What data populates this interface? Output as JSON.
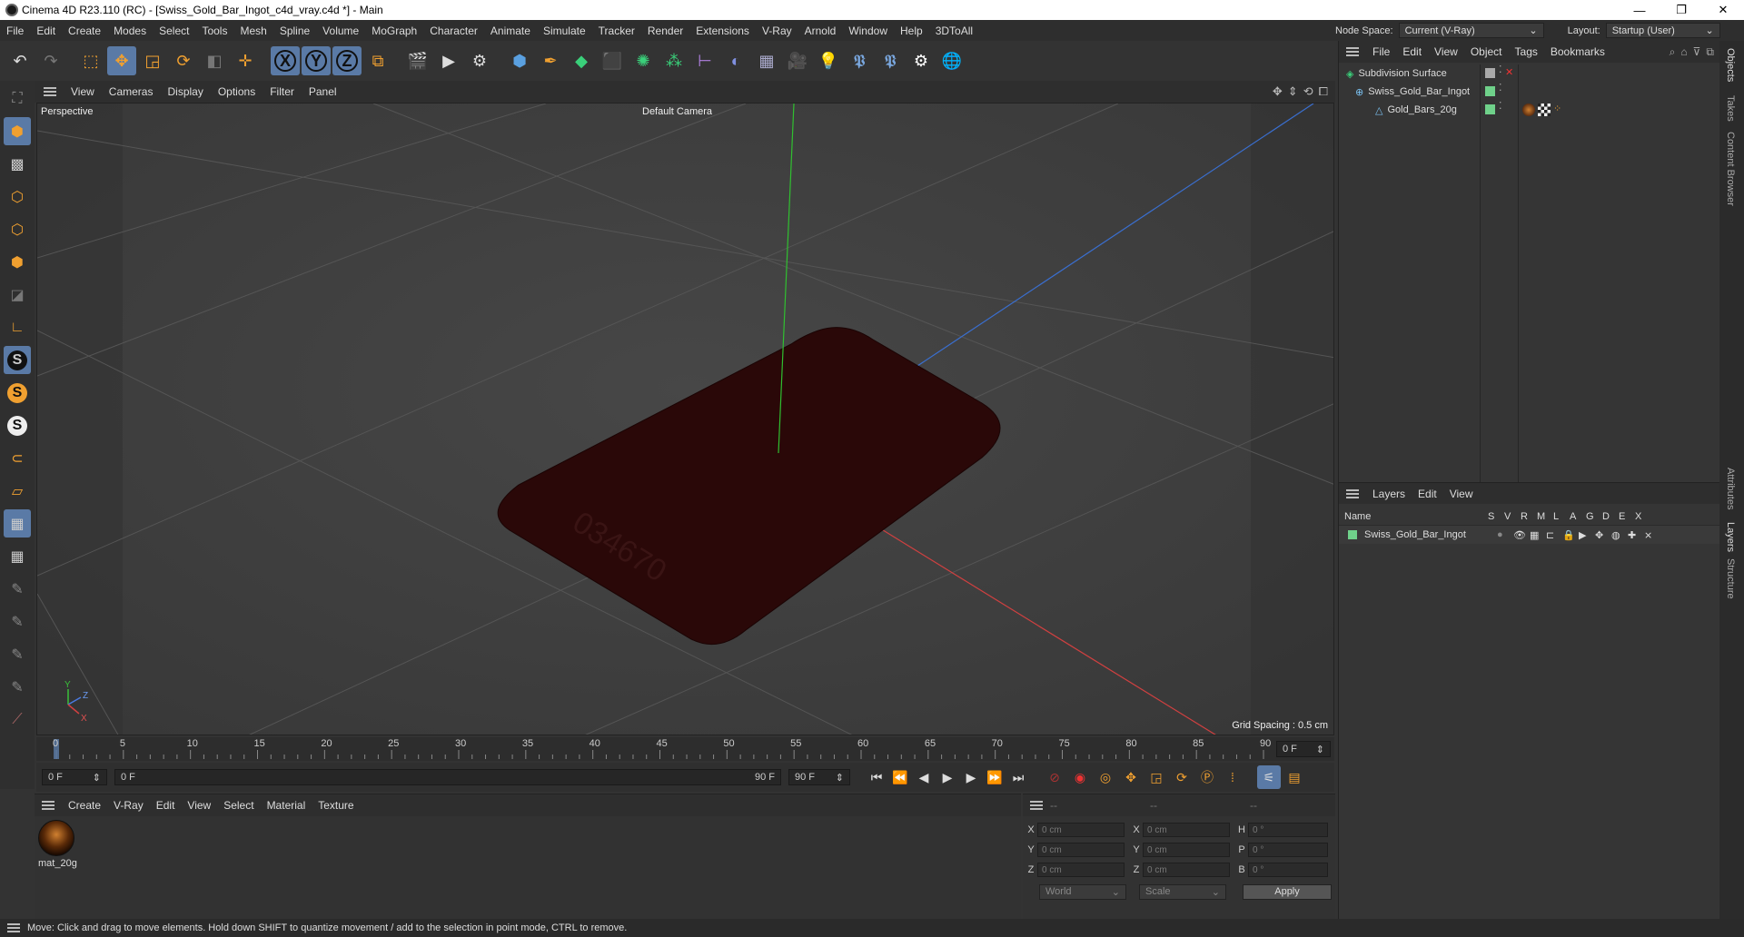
{
  "window": {
    "title": "Cinema 4D R23.110 (RC) - [Swiss_Gold_Bar_Ingot_c4d_vray.c4d *] - Main",
    "minimize": "—",
    "maximize": "❐",
    "close": "✕"
  },
  "menu": [
    "File",
    "Edit",
    "Create",
    "Modes",
    "Select",
    "Tools",
    "Mesh",
    "Spline",
    "Volume",
    "MoGraph",
    "Character",
    "Animate",
    "Simulate",
    "Tracker",
    "Render",
    "Extensions",
    "V-Ray",
    "Arnold",
    "Window",
    "Help",
    "3DToAll"
  ],
  "node_space": {
    "label": "Node Space:",
    "value": "Current (V-Ray)"
  },
  "layout": {
    "label": "Layout:",
    "value": "Startup (User)"
  },
  "viewport": {
    "menu": [
      "View",
      "Cameras",
      "Display",
      "Options",
      "Filter",
      "Panel"
    ],
    "label": "Perspective",
    "camera": "Default Camera",
    "grid_spacing": "Grid Spacing : 0.5 cm",
    "engraving": "034670",
    "axis_y": "Y",
    "axis_z": "Z",
    "axis_x": "X"
  },
  "timeline": {
    "ticks": [
      "0",
      "5",
      "10",
      "15",
      "20",
      "25",
      "30",
      "35",
      "40",
      "45",
      "50",
      "55",
      "60",
      "65",
      "70",
      "75",
      "80",
      "85",
      "90"
    ],
    "current": "0 F"
  },
  "transport": {
    "start": "0 F",
    "range_start": "0 F",
    "range_end": "90 F",
    "end": "90 F"
  },
  "material_manager": {
    "menu": [
      "Create",
      "V-Ray",
      "Edit",
      "View",
      "Select",
      "Material",
      "Texture"
    ],
    "materials": [
      {
        "name": "mat_20g"
      }
    ]
  },
  "coords": {
    "headers": [
      "--",
      "--",
      "--"
    ],
    "rows": [
      {
        "a": "X",
        "av": "0 cm",
        "b": "X",
        "bv": "0 cm",
        "c": "H",
        "cv": "0 °"
      },
      {
        "a": "Y",
        "av": "0 cm",
        "b": "Y",
        "bv": "0 cm",
        "c": "P",
        "cv": "0 °"
      },
      {
        "a": "Z",
        "av": "0 cm",
        "b": "Z",
        "bv": "0 cm",
        "c": "B",
        "cv": "0 °"
      }
    ],
    "space": "World",
    "mode": "Scale",
    "apply": "Apply"
  },
  "objects": {
    "menu": [
      "File",
      "Edit",
      "View",
      "Object",
      "Tags",
      "Bookmarks"
    ],
    "items": [
      {
        "name": "Subdivision Surface",
        "indent": 0
      },
      {
        "name": "Swiss_Gold_Bar_Ingot",
        "indent": 1
      },
      {
        "name": "Gold_Bars_20g",
        "indent": 2
      }
    ]
  },
  "layers": {
    "menu": [
      "Layers",
      "Edit",
      "View"
    ],
    "columns": [
      "Name",
      "S",
      "V",
      "R",
      "M",
      "L",
      "A",
      "G",
      "D",
      "E",
      "X"
    ],
    "items": [
      {
        "name": "Swiss_Gold_Bar_Ingot"
      }
    ]
  },
  "vtabs": [
    "Objects",
    "Takes",
    "Content Browser",
    "Attributes",
    "Layers",
    "Structure"
  ],
  "status": "Move: Click and drag to move elements. Hold down SHIFT to quantize movement / add to the selection in point mode, CTRL to remove.",
  "colors": {
    "accent": "#5a7aa6",
    "layer_green": "#6fd18a",
    "bar": "#2a0808"
  }
}
